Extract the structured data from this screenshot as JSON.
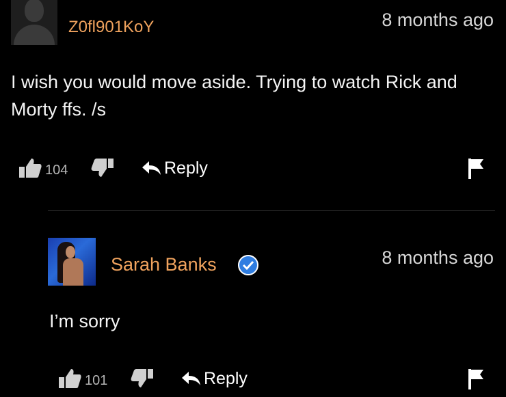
{
  "comments": [
    {
      "username": "Z0fl901KoY",
      "timestamp": "8 months ago",
      "text": "I wish you would move aside. Trying to watch Rick and Morty ffs. /s",
      "likes": "104",
      "reply_label": "Reply",
      "avatar": "default-avatar-icon"
    },
    {
      "username": "Sarah Banks",
      "verified": true,
      "timestamp": "8 months ago",
      "text": "I’m sorry",
      "likes": "101",
      "reply_label": "Reply",
      "avatar": "user-photo"
    }
  ],
  "colors": {
    "background": "#000000",
    "username": "#f0a35e",
    "verified_badge": "#2f7de1",
    "text": "#f4f4f4",
    "muted": "#b5b5b5"
  }
}
